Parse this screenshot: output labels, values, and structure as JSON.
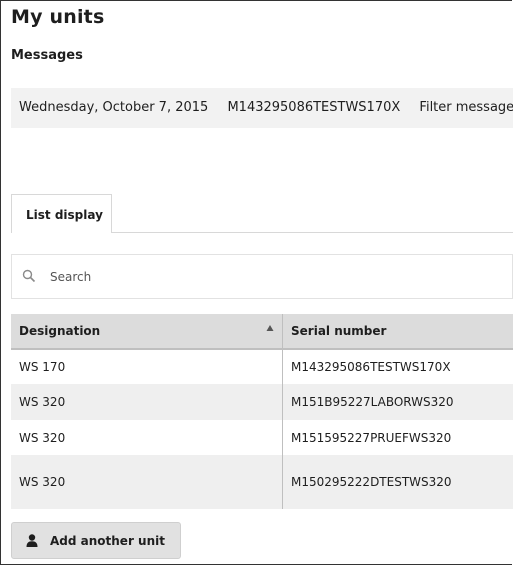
{
  "page": {
    "title": "My units"
  },
  "messages": {
    "heading": "Messages",
    "date": "Wednesday, October 7, 2015",
    "serial": "M143295086TESTWS170X",
    "filter": "Filter message, unit"
  },
  "tabs": [
    {
      "label": "List display"
    }
  ],
  "search": {
    "placeholder": "Search"
  },
  "table": {
    "columns": [
      "Designation",
      "Serial number"
    ],
    "rows": [
      {
        "designation": "WS 170",
        "serial": "M143295086TESTWS170X"
      },
      {
        "designation": "WS 320",
        "serial": "M151B95227LABORWS320"
      },
      {
        "designation": "WS 320",
        "serial": "M151595227PRUEFWS320"
      },
      {
        "designation": "WS 320",
        "serial": "M150295222DTESTWS320"
      }
    ]
  },
  "actions": {
    "add_unit": "Add another unit"
  },
  "icons": {
    "search": "search-icon",
    "sort": "sort-asc-icon",
    "add": "user-icon"
  }
}
